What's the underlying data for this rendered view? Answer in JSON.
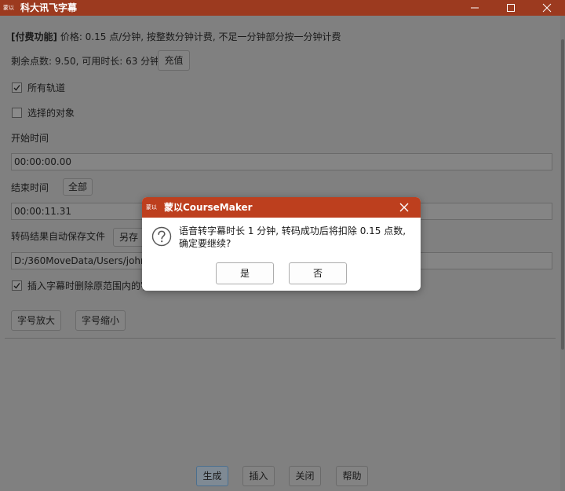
{
  "window": {
    "logo_text": "蒙以",
    "title": "科大讯飞字幕"
  },
  "main": {
    "pricing": {
      "tag": "[付费功能]",
      "text": "价格: 0.15 点/分钟, 按整数分钟计费, 不足一分钟部分按一分钟计费"
    },
    "balance": {
      "text": "剩余点数: 9.50, 可用时长: 63 分钟",
      "recharge_label": "充值"
    },
    "all_tracks": {
      "label": "所有轨道",
      "checked": true
    },
    "selected_objects": {
      "label": "选择的对象",
      "checked": false
    },
    "start_time": {
      "label": "开始时间",
      "value": "00:00:00.00"
    },
    "end_time": {
      "label": "结束时间",
      "all_label": "全部",
      "value": "00:00:11.31"
    },
    "autosave": {
      "label": "转码结果自动保存文件",
      "save_as_label": "另存",
      "path": "D:/360MoveData/Users/john jia"
    },
    "delete_option": {
      "label": "插入字幕时删除原范围内的字",
      "checked": true
    },
    "font_up_label": "字号放大",
    "font_down_label": "字号缩小"
  },
  "footer": {
    "generate_label": "生成",
    "insert_label": "插入",
    "close_label": "关闭",
    "help_label": "帮助"
  },
  "dialog": {
    "logo_text": "蒙以",
    "title": "蒙以CourseMaker",
    "message": "语音转字幕时长 1 分钟, 转码成功后将扣除 0.15 点数, 确定要继续?",
    "yes_label": "是",
    "no_label": "否",
    "icon": "question-icon"
  },
  "colors": {
    "titlebar": "#9c3a1f",
    "dialog_titlebar": "#bd3f1e",
    "overlay_background": "#808080"
  }
}
